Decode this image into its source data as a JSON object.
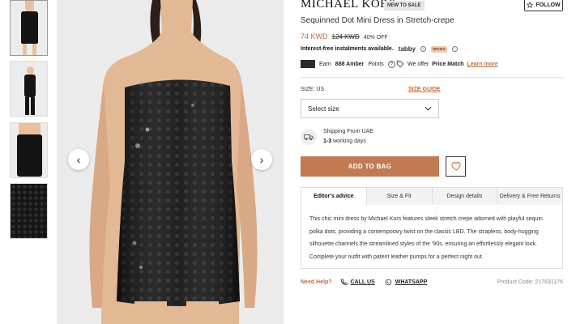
{
  "gallery": {
    "thumbnails": [
      "thumb-front",
      "thumb-side",
      "thumb-closeup",
      "thumb-fabric"
    ],
    "prev_icon": "‹",
    "next_icon": "›"
  },
  "product": {
    "brand": "MICHAEL KORS",
    "badge": "NEW TO SALE",
    "follow_label": "FOLLOW",
    "title": "Sequinned Dot Mini Dress in Stretch-crepe",
    "price_now": "74 KWD",
    "price_was": "124 KWD",
    "discount": "40% OFF",
    "instalments_label": "Interest-free instalments available.",
    "tabby": "tabby",
    "tamara": "tamara",
    "amber_prefix": "Earn",
    "amber_points": "888 Amber",
    "amber_suffix": "Points",
    "price_match_prefix": "We offer",
    "price_match": "Price Match",
    "learn_more": "Learn more"
  },
  "size": {
    "label": "SIZE: US",
    "guide": "SIZE GUIDE",
    "select_placeholder": "Select size"
  },
  "shipping": {
    "title": "Shipping From UAE",
    "days": "1-3",
    "days_suffix": "working days"
  },
  "actions": {
    "add_to_bag": "ADD TO BAG"
  },
  "tabs": [
    {
      "label": "Editor's advice"
    },
    {
      "label": "Size & Fit"
    },
    {
      "label": "Design details"
    },
    {
      "label": "Delivery & Free Returns"
    }
  ],
  "description": "This chic mini dress by Michael Kors features sleek stretch crepe adorned with playful sequin polka dots, providing a contemporary twist on the classic LBD. The strapless, body-hugging silhouette channels the streamlined styles of the '90s, ensuring an effortlessly elegant look. Complete your outfit with patent leather pumps for a perfect night out.",
  "help": {
    "need_help": "Need Help?",
    "call": "CALL US",
    "whatsapp": "WHATSAPP",
    "product_code": "Product Code: 217631176"
  },
  "colors": {
    "accent": "#c06b40",
    "button": "#c17a52"
  }
}
